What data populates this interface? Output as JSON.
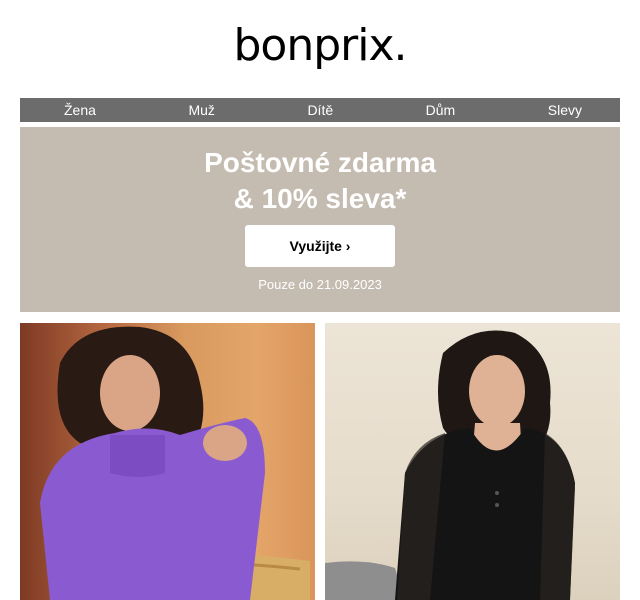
{
  "brand": {
    "logo_text": "bonprix."
  },
  "nav": {
    "items": [
      "Žena",
      "Muž",
      "Dítě",
      "Dům",
      "Slevy"
    ]
  },
  "banner": {
    "title_line1": "Poštovné zdarma",
    "title_line2": "& 10% sleva*",
    "cta_label": "Využijte ›",
    "note": "Pouze do 21.09.2023",
    "background": "#c4bcb1"
  },
  "colors": {
    "nav_bg": "#6c6c6c",
    "sweater_purple": "#8a5bd0"
  }
}
